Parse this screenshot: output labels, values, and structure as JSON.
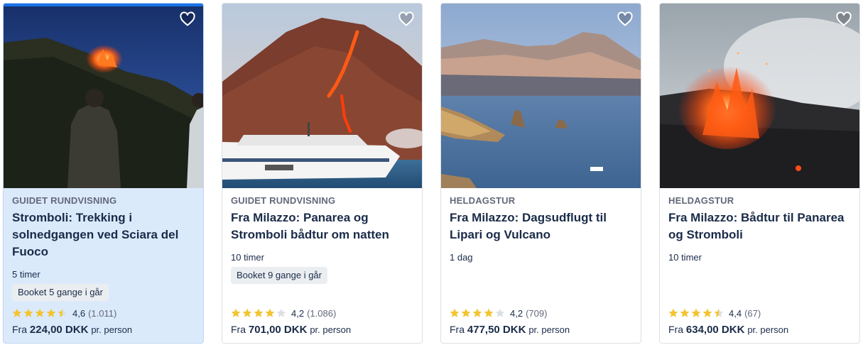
{
  "cards": [
    {
      "category": "GUIDET RUNDVISNING",
      "title": "Stromboli: Trekking i solnedgangen ved Sciara del Fuoco",
      "duration": "5 timer",
      "badge": "Booket 5 gange i går",
      "rating_value": "4,6",
      "rating_count": "(1.011)",
      "stars": 4.6,
      "price_prefix": "Fra",
      "price": "224,00 DKK",
      "price_suffix": "pr. person",
      "highlighted": true
    },
    {
      "category": "GUIDET RUNDVISNING",
      "title": "Fra Milazzo: Panarea og Stromboli bådtur om natten",
      "duration": "10 timer",
      "badge": "Booket 9 gange i går",
      "rating_value": "4,2",
      "rating_count": "(1.086)",
      "stars": 4.2,
      "price_prefix": "Fra",
      "price": "701,00 DKK",
      "price_suffix": "pr. person",
      "highlighted": false
    },
    {
      "category": "HELDAGSTUR",
      "title": "Fra Milazzo: Dagsudflugt til Lipari og Vulcano",
      "duration": "1 dag",
      "badge": "",
      "rating_value": "4,2",
      "rating_count": "(709)",
      "stars": 4.2,
      "price_prefix": "Fra",
      "price": "477,50 DKK",
      "price_suffix": "pr. person",
      "highlighted": false
    },
    {
      "category": "HELDAGSTUR",
      "title": "Fra Milazzo: Bådtur til Panarea og Stromboli",
      "duration": "10 timer",
      "badge": "",
      "rating_value": "4,4",
      "rating_count": "(67)",
      "stars": 4.4,
      "price_prefix": "Fra",
      "price": "634,00 DKK",
      "price_suffix": "pr. person",
      "highlighted": false
    }
  ],
  "colors": {
    "star": "#f4c430",
    "star_empty": "#dcdfe4",
    "accent": "#1a73e8",
    "category": "#63687a"
  },
  "icons": {
    "wishlist": "heart-icon",
    "star": "star-icon"
  }
}
